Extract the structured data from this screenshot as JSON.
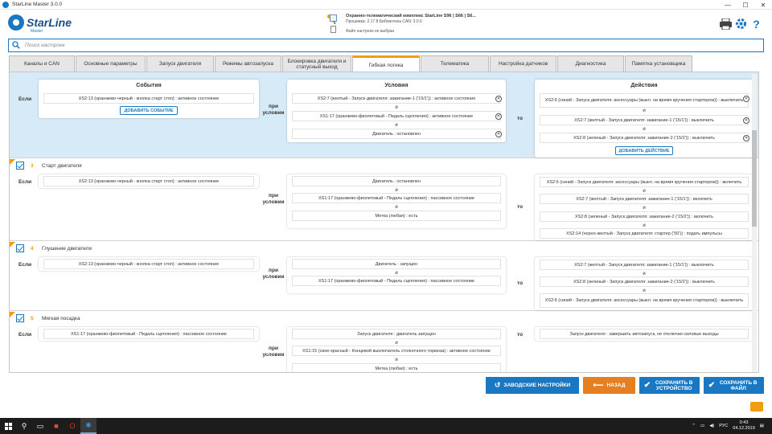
{
  "window": {
    "title": "StarLine Master 3.0.0",
    "minimize": "—",
    "maximize": "☐",
    "close": "✕"
  },
  "header": {
    "logo": "StarLine",
    "logo_sub": "Master",
    "device_line1": "Охранно-телематический комплекс StarLine S96 | S66 | S6...",
    "device_line2": "Прошивка: 2.17.8   Библиотека CAN: 3.0.0",
    "file_line": "Файл настроек не выбран",
    "icons": [
      "printer-icon",
      "gear-icon",
      "help-icon"
    ]
  },
  "search": {
    "placeholder": "Поиск настроек"
  },
  "tabs": [
    "Каналы и CAN",
    "Основные параметры",
    "Запуск двигателя",
    "Режимы автозапуска",
    "Блокировка двигателя и статусный выход",
    "Гибкая логика",
    "Телематика",
    "Настройка датчиков",
    "Диагностика",
    "Памятка установщика"
  ],
  "active_tab": "Гибкая логика",
  "labels": {
    "if": "Если",
    "when": "при условии",
    "then": "то",
    "and": "и",
    "events_title": "События",
    "conditions_title": "Условия",
    "actions_title": "Действия",
    "add_event": "ДОБАВИТЬ СОБЫТИЕ",
    "add_action": "ДОБАВИТЬ ДЕЙСТВИЕ"
  },
  "rules": [
    {
      "events": [
        "XS2:13 (оранжево-черный - кнопка старт стоп) : активное состояние"
      ],
      "conditions": [
        "XS2:7 (желтый - Запуск двигателя: зажигание-1 ('15/1')) : активное состояние",
        "XS1:17 (оранжево-фиолетовый - Педаль сцепления) : активное состояние",
        "Двигатель : остановлен"
      ],
      "actions": [
        "XS2:6 (синий - Запуск двигателя: аксессуары (выкл. на время кручения стартером)) : выключить",
        "XS2:7 (желтый - Запуск двигателя: зажигание-1 ('15/1')) : выключить",
        "XS2:8 (зеленый - Запуск двигателя: зажигание-2 ('15/2')) : выключить"
      ]
    },
    {
      "num": "3",
      "name": "Старт двигателя",
      "events": [
        "XS2:13 (оранжево-черный - кнопка старт стоп) : активное состояние"
      ],
      "conditions": [
        "Двигатель : остановлен",
        "XS1:17 (оранжево-фиолетовый - Педаль сцепления) : пассивное состояние",
        "Метка (любая) : есть"
      ],
      "actions": [
        "XS2:6 (синий - Запуск двигателя: аксессуары (выкл. на время кручения стартером)) : включить",
        "XS2:7 (желтый - Запуск двигателя: зажигание-1 ('15/1')) : включить",
        "XS2:8 (зеленый - Запуск двигателя: зажигание-2 ('15/2')) : включить",
        "XS2:14 (черно-желтый - Запуск двигателя: стартер ('50')) : подать импульсы"
      ]
    },
    {
      "num": "4",
      "name": "Глушение двигателя",
      "events": [
        "XS2:13 (оранжево-черный - кнопка старт стоп) : активное состояние"
      ],
      "conditions": [
        "Двигатель : запущен",
        "XS1:17 (оранжево-фиолетовый - Педаль сцепления) : пассивное состояние"
      ],
      "actions": [
        "XS2:7 (желтый - Запуск двигателя: зажигание-1 ('15/1')) : выключить",
        "XS2:8 (зеленый - Запуск двигателя: зажигание-2 ('15/2')) : выключить",
        "XS2:6 (синий - Запуск двигателя: аксессуары (выкл. на время кручения стартером)) : выключить"
      ]
    },
    {
      "num": "5",
      "name": "Мягкая посадка",
      "events": [
        "XS1:17 (оранжево-фиолетовый - Педаль сцепления) : пассивное состояние"
      ],
      "conditions": [
        "Запуск двигателя : двигатель запущен",
        "XS1:15 (сине-красный - Концевой выключатель стояночного тормоза) : активное состояние",
        "Метка (любая) : есть"
      ],
      "actions": [
        "Запуск двигателя : завершить автозапуск, не отключая силовые выходы"
      ]
    }
  ],
  "buttons": {
    "factory": "ЗАВОДСКИЕ НАСТРОЙКИ",
    "back": "НАЗАД",
    "save_device": "СОХРАНИТЬ В УСТРОЙСТВО",
    "save_file": "СОХРАНИТЬ В ФАЙЛ"
  },
  "taskbar": {
    "lang": "РУС",
    "time": "0:43",
    "date": "04.12.2019"
  },
  "colors": {
    "accent": "#1a78c2",
    "orange": "#f39c12",
    "selected_row": "#d7eaf8"
  }
}
